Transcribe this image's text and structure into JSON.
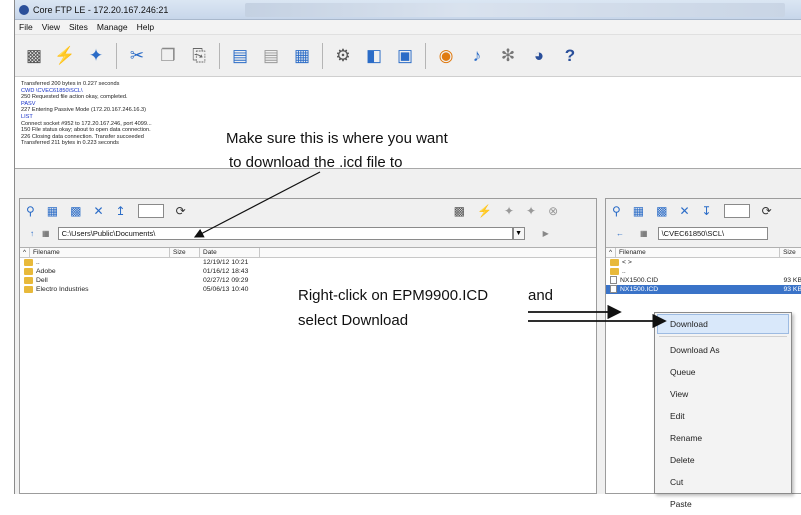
{
  "window": {
    "title": "Core FTP LE - 172.20.167.246:21"
  },
  "menu": [
    "File",
    "View",
    "Sites",
    "Manage",
    "Help"
  ],
  "toolbar_icons": [
    "disconnect-icon",
    "lightning-icon",
    "connect-icon",
    "cut-icon",
    "copy-icon",
    "paste-icon",
    "view-icon",
    "edit-icon",
    "log-icon",
    "settings-icon",
    "properties-icon",
    "options-icon",
    "eye-icon",
    "sound-icon",
    "filter-icon",
    "speed-icon",
    "help-icon"
  ],
  "log": [
    {
      "text": "Transferred 200 bytes in 0.227 seconds",
      "blue": false
    },
    {
      "text": "CWD \\CVEC61850\\SCL\\",
      "blue": true
    },
    {
      "text": "250 Requested file action okay, completed.",
      "blue": false
    },
    {
      "text": "PASV",
      "blue": true
    },
    {
      "text": "227 Entering Passive Mode (172.20.167.246.16.3)",
      "blue": false
    },
    {
      "text": "LIST",
      "blue": true
    },
    {
      "text": "Connect socket #952 to 172.20.167.246, port 4099...",
      "blue": false
    },
    {
      "text": "150 File status okay; about to open data connection.",
      "blue": false
    },
    {
      "text": "226 Closing data connection. Transfer succeeded",
      "blue": false
    },
    {
      "text": "Transferred 211 bytes in 0.223 seconds",
      "blue": false
    }
  ],
  "annotations": {
    "a1_line1": "Make sure this is where you want",
    "a1_line2": "to download the .icd file to",
    "a2_part1": "Right-click on EPM9900.ICD",
    "a2_part2": "and",
    "a2_line2": "select Download"
  },
  "left_panel": {
    "path": "C:\\Users\\Public\\Documents\\",
    "columns": [
      "Filename",
      "Size",
      "Date"
    ],
    "rows": [
      {
        "name": "..",
        "size": "",
        "date": "12/19/12  10:21"
      },
      {
        "name": "Adobe",
        "size": "",
        "date": "01/16/12  18:43"
      },
      {
        "name": "Dell",
        "size": "",
        "date": "02/27/12  09:29"
      },
      {
        "name": "Electro Industries",
        "size": "",
        "date": "05/06/13  10:40"
      }
    ]
  },
  "right_panel": {
    "path": "\\CVEC61850\\SCL\\",
    "columns": [
      "Filename",
      "Size"
    ],
    "rows": [
      {
        "name": "< >",
        "size": "",
        "type": "folder"
      },
      {
        "name": "..",
        "size": "",
        "type": "folder"
      },
      {
        "name": "NX1500.CID",
        "size": "93 KB",
        "type": "file"
      },
      {
        "name": "NX1500.ICD",
        "size": "93 KB",
        "type": "file"
      }
    ]
  },
  "context_menu": [
    "Download",
    "Download As",
    "Queue",
    "View",
    "Edit",
    "Rename",
    "Delete",
    "Cut",
    "Paste"
  ]
}
